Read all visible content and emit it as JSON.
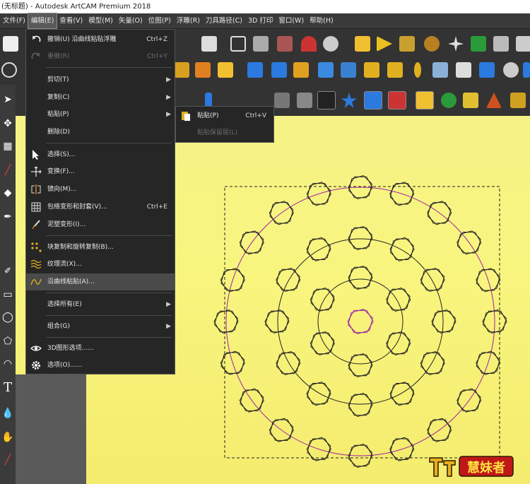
{
  "window": {
    "title": "(无标题) - Autodesk ArtCAM Premium 2018"
  },
  "menubar": {
    "items": [
      "文件(F)",
      "编辑(E)",
      "查看(V)",
      "模型(M)",
      "矢量(O)",
      "位图(P)",
      "浮雕(R)",
      "刀具路径(C)",
      "3D 打印",
      "窗口(W)",
      "帮助(H)"
    ],
    "active": "编辑(E)"
  },
  "edit_menu": {
    "undo": {
      "label": "撤销(U) 沿曲线粘贴浮雕",
      "shortcut": "Ctrl+Z"
    },
    "redo": {
      "label": "重做(R)",
      "shortcut": "Ctrl+Y"
    },
    "cut": {
      "label": "剪切(T)"
    },
    "copy": {
      "label": "复制(C)"
    },
    "paste": {
      "label": "粘贴(P)"
    },
    "delete": {
      "label": "删除(D)"
    },
    "select": {
      "label": "选择(S)..."
    },
    "transform": {
      "label": "变换(F)..."
    },
    "mirror": {
      "label": "镜向(M)..."
    },
    "wrap": {
      "label": "包络变形和封套(V)...",
      "shortcut": "Ctrl+E"
    },
    "mud": {
      "label": "泥塑变形(I)..."
    },
    "block_copy": {
      "label": "块复制和旋转复制(B)..."
    },
    "texture_flow": {
      "label": "纹理流(X)..."
    },
    "paste_along_curve": {
      "label": "沿曲线粘贴(A)..."
    },
    "select_all": {
      "label": "选择所有(E)"
    },
    "group": {
      "label": "组合(G)"
    },
    "view3d": {
      "label": "3D图形选项......"
    },
    "options": {
      "label": "选项(O)......"
    }
  },
  "paste_submenu": {
    "paste": {
      "label": "粘贴(P)",
      "shortcut": "Ctrl+V"
    },
    "paste_keep_layer": {
      "label": "粘贴保留层(L)"
    }
  },
  "watermark": {
    "text": "慧妹者"
  },
  "colors": {
    "accent_magenta": "#a020a0",
    "canvas_yellow": "#f6f286"
  }
}
